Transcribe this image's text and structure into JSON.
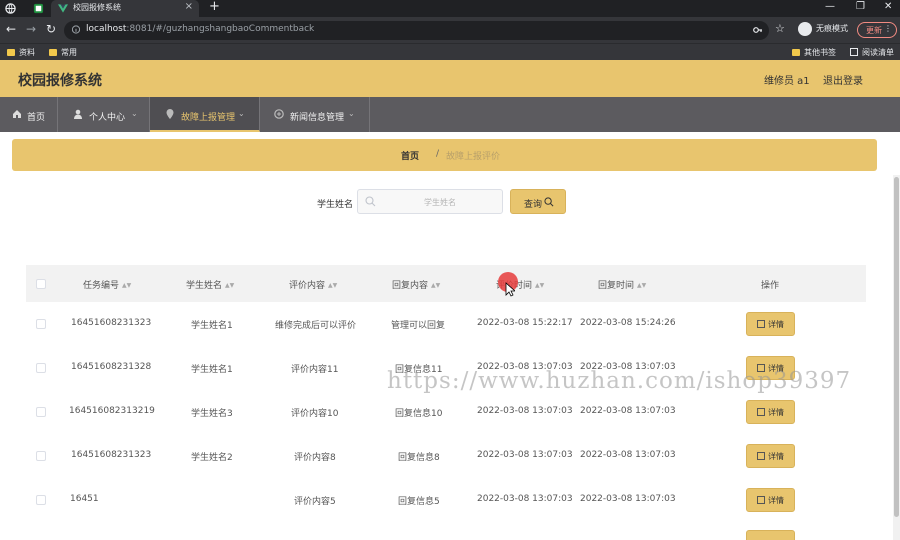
{
  "browser": {
    "tab_title": "校园报修系统",
    "url_host": "localhost",
    "url_rest": ":8081/#/guzhangshangbaoCommentback",
    "incognito_label": "无痕模式",
    "update_label": "更新",
    "bookmarks": [
      "资料",
      "常用"
    ],
    "other_bookmarks": "其他书签",
    "reading_list": "阅读清单"
  },
  "header": {
    "title": "校园报修系统",
    "user_role": "维修员 a1",
    "logout": "退出登录"
  },
  "menu": {
    "items": [
      {
        "label": "首页",
        "icon": "home-icon"
      },
      {
        "label": "个人中心",
        "icon": "user-icon"
      },
      {
        "label": "故障上报管理",
        "icon": "location-icon",
        "active": true
      },
      {
        "label": "新闻信息管理",
        "icon": "news-icon"
      }
    ]
  },
  "breadcrumb": {
    "home": "首页",
    "separator": "/",
    "current": "故障上报评价"
  },
  "search": {
    "label": "学生姓名",
    "placeholder": "学生姓名",
    "button": "查询"
  },
  "table": {
    "columns": [
      "任务编号",
      "学生姓名",
      "评价内容",
      "回复内容",
      "评价时间",
      "回复时间",
      "操作"
    ],
    "rows": [
      {
        "id": "16451608231323",
        "name": "学生姓名1",
        "comment": "维修完成后可以评价",
        "reply": "管理可以回复",
        "comment_time": "2022-03-08 15:22:17",
        "reply_time": "2022-03-08 15:24:26"
      },
      {
        "id": "16451608231328",
        "name": "学生姓名1",
        "comment": "评价内容11",
        "reply": "回复信息11",
        "comment_time": "2022-03-08 13:07:03",
        "reply_time": "2022-03-08 13:07:03"
      },
      {
        "id": "164516082313219",
        "name": "学生姓名3",
        "comment": "评价内容10",
        "reply": "回复信息10",
        "comment_time": "2022-03-08 13:07:03",
        "reply_time": "2022-03-08 13:07:03"
      },
      {
        "id": "16451608231323",
        "name": "学生姓名2",
        "comment": "评价内容8",
        "reply": "回复信息8",
        "comment_time": "2022-03-08 13:07:03",
        "reply_time": "2022-03-08 13:07:03"
      },
      {
        "id": "16451",
        "name": "",
        "comment": "评价内容5",
        "reply": "回复信息5",
        "comment_time": "2022-03-08 13:07:03",
        "reply_time": "2022-03-08 13:07:03"
      }
    ],
    "detail_label": "详情"
  },
  "watermark": "https://www.huzhan.com/ishop39397",
  "colors": {
    "accent": "#e8c56e",
    "menu_bg": "#5c5b5f"
  }
}
